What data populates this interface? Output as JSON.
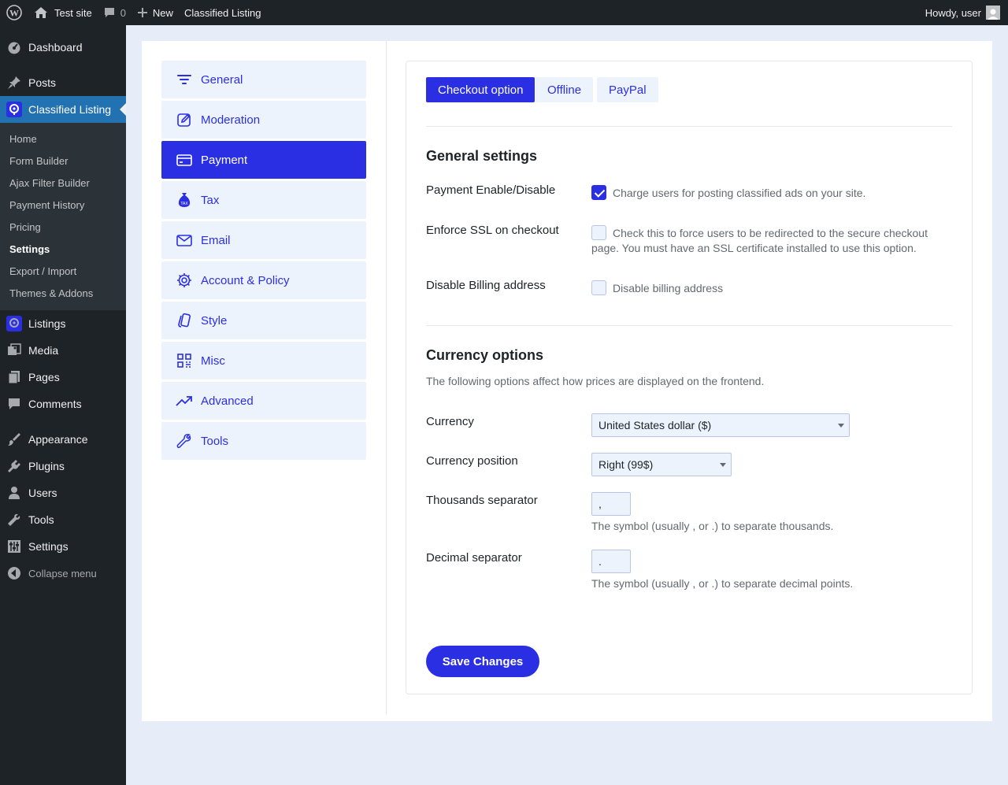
{
  "admin_bar": {
    "site_name": "Test site",
    "comments_count": "0",
    "new_label": "New",
    "plugin_link": "Classified Listing",
    "greeting": "Howdy, user"
  },
  "sidebar": {
    "dashboard": "Dashboard",
    "posts": "Posts",
    "classified_listing": "Classified Listing",
    "submenu": [
      "Home",
      "Form Builder",
      "Ajax Filter Builder",
      "Payment History",
      "Pricing",
      "Settings",
      "Export / Import",
      "Themes & Addons"
    ],
    "listings": "Listings",
    "media": "Media",
    "pages": "Pages",
    "comments": "Comments",
    "appearance": "Appearance",
    "plugins": "Plugins",
    "users": "Users",
    "tools": "Tools",
    "settings": "Settings",
    "collapse": "Collapse menu"
  },
  "settings_tabs": [
    "General",
    "Moderation",
    "Payment",
    "Tax",
    "Email",
    "Account & Policy",
    "Style",
    "Misc",
    "Advanced",
    "Tools"
  ],
  "active_settings_tab": "Payment",
  "sub_tabs": [
    "Checkout option",
    "Offline",
    "PayPal"
  ],
  "general_settings": {
    "title": "General settings",
    "payment_enable": {
      "label": "Payment Enable/Disable",
      "checked": true,
      "text": "Charge users for posting classified ads on your site."
    },
    "enforce_ssl": {
      "label": "Enforce SSL on checkout",
      "checked": false,
      "text": "Check this to force users to be redirected to the secure checkout page. You must have an SSL certificate installed to use this option."
    },
    "disable_billing": {
      "label": "Disable Billing address",
      "checked": false,
      "text": "Disable billing address"
    }
  },
  "currency_options": {
    "title": "Currency options",
    "description": "The following options affect how prices are displayed on the frontend.",
    "currency": {
      "label": "Currency",
      "value": "United States dollar ($)"
    },
    "currency_position": {
      "label": "Currency position",
      "value": "Right (99$)"
    },
    "thousands_separator": {
      "label": "Thousands separator",
      "value": ",",
      "help": "The symbol (usually , or .) to separate thousands."
    },
    "decimal_separator": {
      "label": "Decimal separator",
      "value": ".",
      "help": "The symbol (usually , or .) to separate decimal points."
    }
  },
  "save_button": "Save Changes",
  "colors": {
    "accent": "#2b2fe3",
    "admin_bg": "#1d2327",
    "wp_blue": "#2271b1",
    "tab_bg": "#edf3fc"
  }
}
